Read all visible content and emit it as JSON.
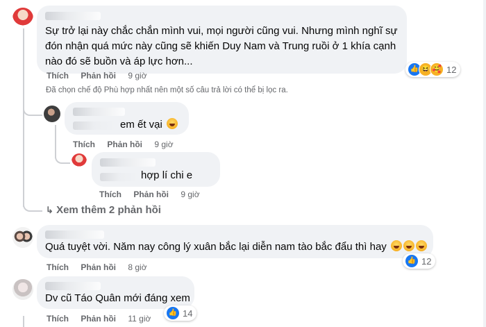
{
  "comments": [
    {
      "text": "Sự trở lại này chắc chắn mình vui, mọi người cũng vui. Nhưng mình nghĩ sự đón nhận quá mức này cũng sẽ khiến Duy Nam và Trung ruồi ở 1 khía cạnh nào đó sẽ buồn và áp lực hơn...",
      "like": "Thích",
      "reply": "Phản hồi",
      "time": "9 giờ",
      "reaction_count": "12",
      "reactions": [
        "like-icon",
        "haha-icon",
        "care-icon"
      ]
    },
    {
      "text": "em ết vại",
      "like": "Thích",
      "reply": "Phản hồi",
      "time": "9 giờ"
    },
    {
      "text": "hợp lí chi e",
      "like": "Thích",
      "reply": "Phản hồi",
      "time": "9 giờ"
    },
    {
      "text": "Quá tuyệt vời. Năm nay công lý xuân bắc lại diễn nam tào bắc đẩu thì hay",
      "like": "Thích",
      "reply": "Phản hồi",
      "time": "8 giờ",
      "reaction_count": "12",
      "reactions": [
        "like-icon"
      ]
    },
    {
      "text": "Dv cũ Táo Quân mới đáng xem",
      "like": "Thích",
      "reply": "Phản hồi",
      "time": "11 giờ",
      "reaction_count": "14",
      "reactions": [
        "like-icon"
      ]
    }
  ],
  "filter_note": "Đã chọn chế độ Phù hợp nhất nên một số câu trả lời có thể bị lọc ra.",
  "more_replies": "Xem thêm 2 phản hồi",
  "colors": {
    "bubble": "#f0f2f5",
    "meta": "#65676b",
    "like_blue": "#1877f2",
    "haha_yellow": "#f7b125"
  }
}
